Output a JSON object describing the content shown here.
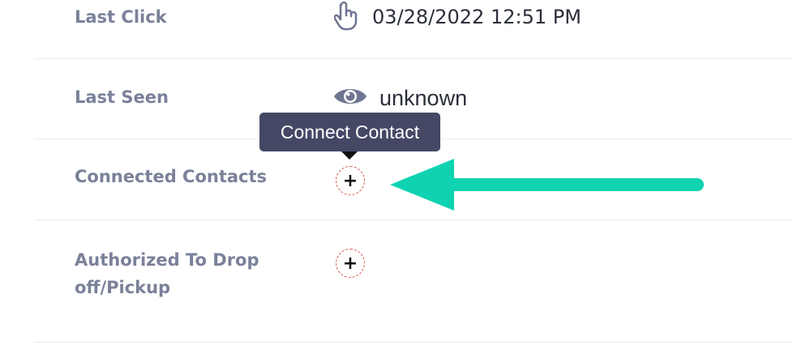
{
  "rows": [
    {
      "label": "Last Click",
      "icon": "hand-pointer-icon",
      "value": "03/28/2022 12:51 PM"
    },
    {
      "label": "Last Seen",
      "icon": "eye-icon",
      "value": "unknown"
    },
    {
      "label": "Connected Contacts",
      "action": "+"
    },
    {
      "label": "Authorized To Drop off/Pickup",
      "action": "+"
    }
  ],
  "tooltip": {
    "text": "Connect Contact"
  },
  "annotation": {
    "type": "arrow",
    "color": "#0fd3b0",
    "points_to": "connected-contacts-add-button"
  }
}
